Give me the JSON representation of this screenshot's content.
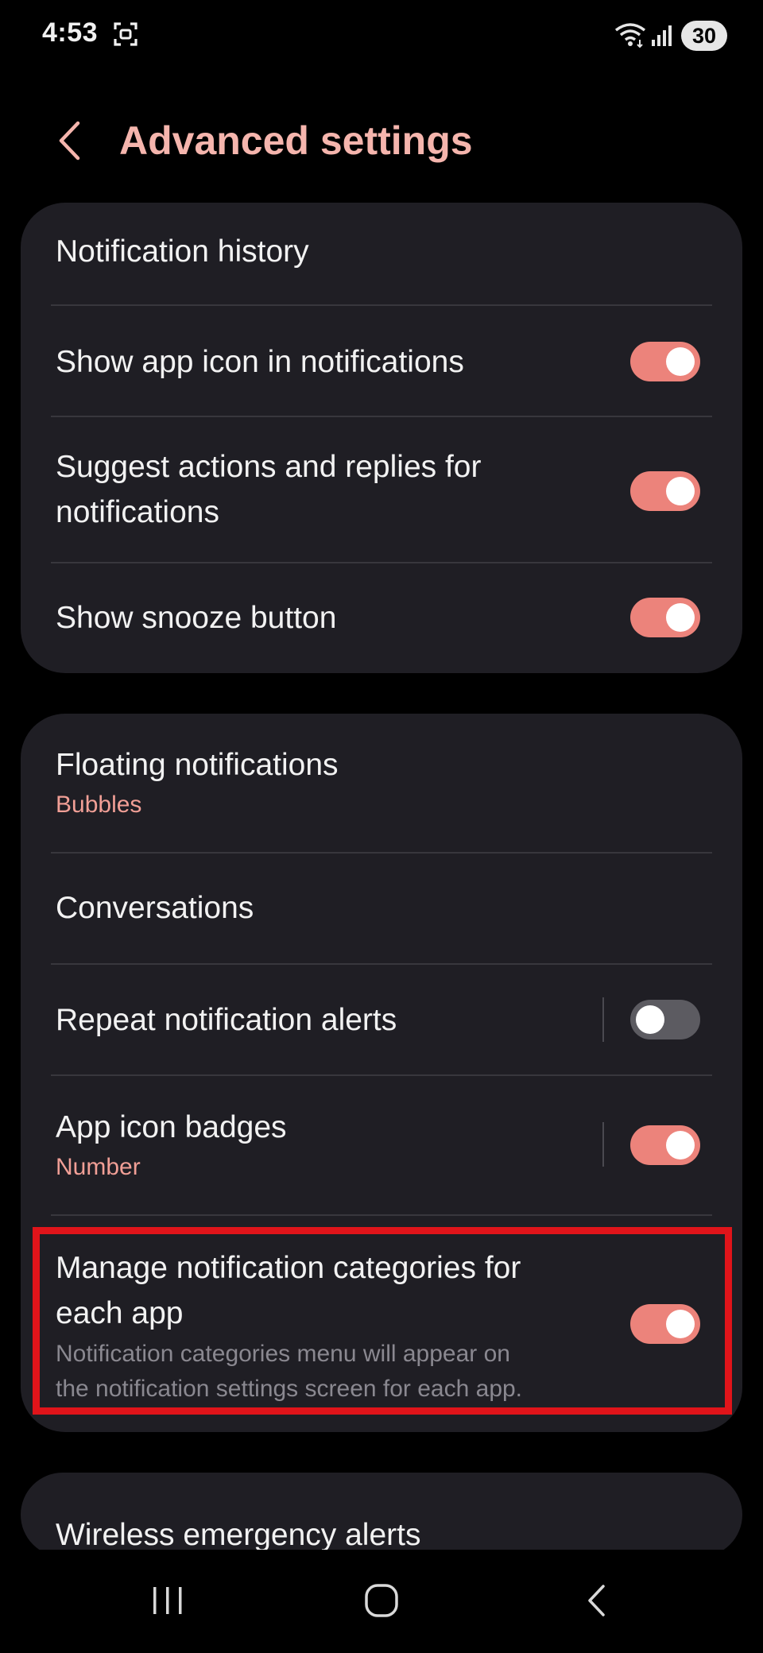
{
  "status_bar": {
    "time": "4:53",
    "battery": "30",
    "icons": [
      "screenshot-icon",
      "wifi-icon",
      "signal-icon"
    ]
  },
  "header": {
    "back_icon": "chevron-left-icon",
    "title": "Advanced settings"
  },
  "card1": {
    "items": [
      {
        "title": "Notification history"
      },
      {
        "title": "Show app icon in notifications",
        "toggle": true
      },
      {
        "title_line1": "Suggest actions and replies for",
        "title_line2": "notifications",
        "toggle": true
      },
      {
        "title": "Show snooze button",
        "toggle": true
      }
    ]
  },
  "card2": {
    "items": [
      {
        "title": "Floating notifications",
        "subtitle": "Bubbles"
      },
      {
        "title": "Conversations"
      },
      {
        "title": "Repeat notification alerts",
        "toggle": false
      },
      {
        "title": "App icon badges",
        "subtitle": "Number",
        "toggle": true
      },
      {
        "title_line1": "Manage notification categories for",
        "title_line2": "each app",
        "desc_line1": "Notification categories menu will appear on",
        "desc_line2": "the notification settings screen for each app.",
        "toggle": true
      }
    ]
  },
  "card3": {
    "items": [
      {
        "title": "Wireless emergency alerts"
      }
    ]
  },
  "nav_bar": {
    "icons": [
      "recent-apps-icon",
      "home-icon",
      "back-icon"
    ]
  },
  "colors": {
    "accent": "#f5b5ad",
    "subtitle": "#f19f96",
    "toggle_on": "#ec837b",
    "toggle_off": "#5c5b61",
    "card_bg": "#1f1e24",
    "highlight": "#e0141a"
  }
}
